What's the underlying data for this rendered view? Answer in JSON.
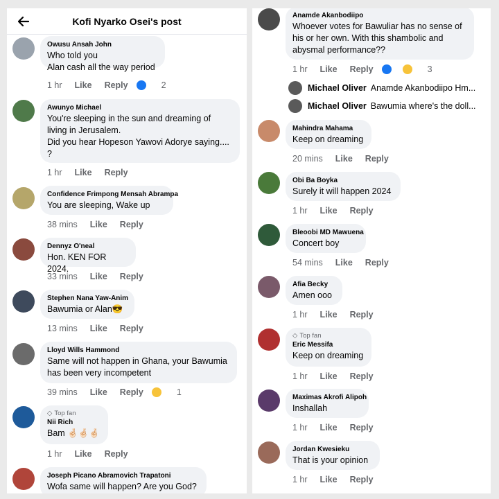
{
  "header": {
    "title": "Kofi Nyarko Osei's post"
  },
  "left_comments": [
    {
      "author": "Owusu Ansah John",
      "text": "Who told you\nAlan cash all the way period",
      "time": "1 hr",
      "like": "Like",
      "reply": "Reply",
      "count": "2"
    },
    {
      "author": "Awunyo Michael",
      "text": "You're sleeping in the sun and dreaming of\nliving in Jerusalem.\nDid you hear Hopeson Yawovi Adorye saying....\n?",
      "time": "1 hr",
      "like": "Like",
      "reply": "Reply"
    },
    {
      "author": "Confidence Frimpong Mensah Abrampa",
      "text": "You are sleeping, Wake up",
      "time": "38 mins",
      "like": "Like",
      "reply": "Reply"
    },
    {
      "author": "Dennyz O'neal",
      "text": "Hon. KEN FOR 2024.",
      "time": "33 mins",
      "like": "Like",
      "reply": "Reply"
    },
    {
      "author": "Stephen Nana Yaw-Anim",
      "text": "Bawumia or Alan😎",
      "time": "13 mins",
      "like": "Like",
      "reply": "Reply"
    },
    {
      "author": "Lloyd Wills Hammond",
      "text": "Same will not happen in Ghana, your Bawumia\nhas been very incompetent",
      "time": "39 mins",
      "like": "Like",
      "reply": "Reply",
      "count": "1"
    },
    {
      "top_fan": "Top fan",
      "author": "Nii Rich",
      "text": "Bam 🤞🏻🤞🏻🤞🏻",
      "time": "1 hr",
      "like": "Like",
      "reply": "Reply"
    },
    {
      "author": "Joseph Picano Abramovich Trapatoni",
      "text": "Wofa same will happen? Are you God?"
    }
  ],
  "right_comments": [
    {
      "author": "Anamde Akanbodiipo",
      "text": "Whoever votes for Bawuliar has no sense of\nhis or her own. With this shambolic and\nabysmal performance??",
      "time": "1 hr",
      "like": "Like",
      "reply": "Reply",
      "count": "3"
    },
    {
      "author": "Mahindra Mahama",
      "text": "Keep on dreaming",
      "time": "20 mins",
      "like": "Like",
      "reply": "Reply"
    },
    {
      "author": "Obi Ba Boyka",
      "text": "Surely it will happen 2024",
      "time": "1 hr",
      "like": "Like",
      "reply": "Reply"
    },
    {
      "author": "Bleoobi MD Mawuena",
      "text": "Concert boy",
      "time": "54 mins",
      "like": "Like",
      "reply": "Reply"
    },
    {
      "author": "Afia Becky",
      "text": "Amen ooo",
      "time": "1 hr",
      "like": "Like",
      "reply": "Reply"
    },
    {
      "top_fan": "Top fan",
      "author": "Eric Messifa",
      "text": "Keep on dreaming",
      "time": "1 hr",
      "like": "Like",
      "reply": "Reply"
    },
    {
      "author": "Maximas Akrofi Alipoh",
      "text": "Inshallah",
      "time": "1 hr",
      "like": "Like",
      "reply": "Reply"
    },
    {
      "author": "Jordan Kwesieku",
      "text": "That is your opinion",
      "time": "1 hr",
      "like": "Like",
      "reply": "Reply"
    }
  ],
  "replies": [
    {
      "name": "Michael Oliver",
      "text": "Anamde Akanbodiipo Hm..."
    },
    {
      "name": "Michael Oliver",
      "text": "Bawumia where's the doll..."
    }
  ],
  "colors": {
    "bubble": "#f0f2f5",
    "meta": "#65676b",
    "like_blue": "#1877f2",
    "haha_yellow": "#f7c33a"
  },
  "icons": {
    "back": "arrow-left-icon",
    "like": "like-reaction-icon",
    "haha": "haha-reaction-icon",
    "top_fan": "diamond-icon"
  }
}
